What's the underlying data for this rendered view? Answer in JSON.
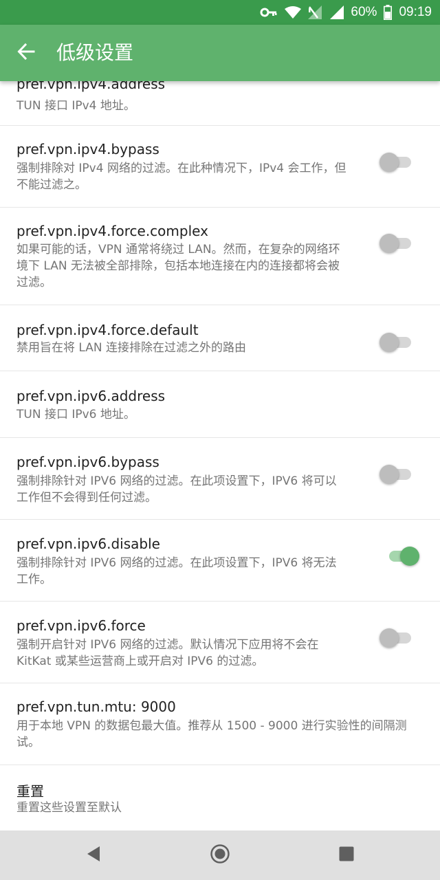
{
  "status_bar": {
    "battery": "60%",
    "time": "09:19"
  },
  "app_bar": {
    "title": "低级设置"
  },
  "settings": [
    {
      "title": "pref.vpn.ipv4.address",
      "summary": "TUN 接口 IPv4 地址。"
    },
    {
      "title": "pref.vpn.ipv4.bypass",
      "summary": "强制排除对 IPv4 网络的过滤。在此种情况下，IPv4 会工作，但不能过滤之。",
      "switch": "off"
    },
    {
      "title": "pref.vpn.ipv4.force.complex",
      "summary": "如果可能的话，VPN 通常将绕过 LAN。然而，在复杂的网络环境下 LAN 无法被全部排除，包括本地连接在内的连接都将会被过滤。",
      "switch": "off"
    },
    {
      "title": "pref.vpn.ipv4.force.default",
      "summary": "禁用旨在将 LAN 连接排除在过滤之外的路由",
      "switch": "off"
    },
    {
      "title": "pref.vpn.ipv6.address",
      "summary": "TUN 接口 IPv6 地址。"
    },
    {
      "title": "pref.vpn.ipv6.bypass",
      "summary": "强制排除针对 IPV6 网络的过滤。在此项设置下，IPV6 将可以工作但不会得到任何过滤。",
      "switch": "off"
    },
    {
      "title": "pref.vpn.ipv6.disable",
      "summary": "强制排除针对 IPV6 网络的过滤。在此项设置下，IPV6 将无法工作。",
      "switch": "on"
    },
    {
      "title": "pref.vpn.ipv6.force",
      "summary": "强制开启针对 IPV6 网络的过滤。默认情况下应用将不会在 KitKat 或某些运营商上或开启对 IPV6 的过滤。",
      "switch": "off"
    },
    {
      "title": "pref.vpn.tun.mtu: 9000",
      "summary": "用于本地 VPN 的数据包最大值。推荐从 1500 - 9000 进行实验性的间隔测试。"
    },
    {
      "title": "重置",
      "summary": "重置这些设置至默认"
    }
  ],
  "colors": {
    "status_bar": "#3a9b4c",
    "app_bar": "#5fb26d",
    "accent": "#5fb26d"
  },
  "icons": {
    "back": "arrow-back-icon",
    "key": "vpn-key-icon",
    "wifi": "wifi-icon",
    "signal_off": "signal-no-data-icon",
    "signal": "cell-signal-icon",
    "battery": "battery-icon",
    "nav_back": "nav-back-icon",
    "nav_home": "nav-home-icon",
    "nav_recents": "nav-recents-icon"
  }
}
